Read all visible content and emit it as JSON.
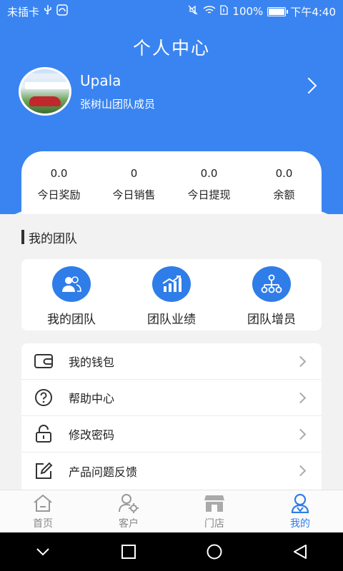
{
  "status_bar": {
    "carrier": "未插卡",
    "battery": "100%",
    "battery_level": 1.0,
    "time": "下午4:40"
  },
  "header": {
    "title": "个人中心"
  },
  "profile": {
    "name": "Upala",
    "role": "张树山团队成员",
    "avatar_icon": "avatar-photo-car"
  },
  "stats": [
    {
      "value": "0.0",
      "label": "今日奖励"
    },
    {
      "value": "0",
      "label": "今日销售"
    },
    {
      "value": "0.0",
      "label": "今日提现"
    },
    {
      "value": "0.0",
      "label": "余额"
    }
  ],
  "team_section": {
    "title": "我的团队",
    "items": [
      {
        "label": "我的团队",
        "icon": "team-members-icon"
      },
      {
        "label": "团队业绩",
        "icon": "performance-chart-icon"
      },
      {
        "label": "团队增员",
        "icon": "team-structure-icon"
      }
    ]
  },
  "menu": [
    {
      "label": "我的钱包",
      "icon": "wallet-icon"
    },
    {
      "label": "帮助中心",
      "icon": "help-icon"
    },
    {
      "label": "修改密码",
      "icon": "lock-icon"
    },
    {
      "label": "产品问题反馈",
      "icon": "edit-icon"
    }
  ],
  "tabs": [
    {
      "label": "首页",
      "icon": "home-icon",
      "active": false
    },
    {
      "label": "客户",
      "icon": "customer-icon",
      "active": false
    },
    {
      "label": "门店",
      "icon": "store-icon",
      "active": false
    },
    {
      "label": "我的",
      "icon": "profile-icon",
      "active": true
    }
  ],
  "colors": {
    "primary": "#3a84f1",
    "accent": "#2f7de8",
    "background": "#f2f2f2",
    "tab_inactive": "#888888"
  }
}
